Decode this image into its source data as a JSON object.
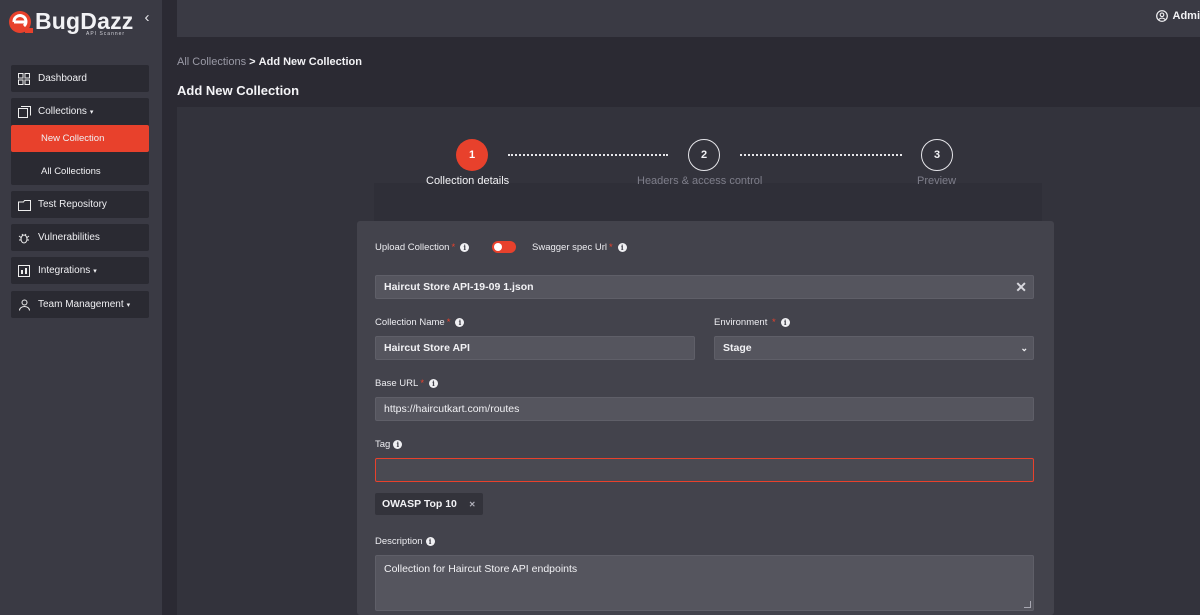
{
  "app": {
    "logo_text": "BugDazz",
    "logo_sub": "API Scanner"
  },
  "sidebar": {
    "items": [
      {
        "label": "Dashboard",
        "icon": "dashboard-grid-icon"
      },
      {
        "label": "Collections",
        "icon": "collections-icon",
        "submenu": [
          "New Collection",
          "All Collections"
        ]
      },
      {
        "label": "Test Repository",
        "icon": "test-repository-icon"
      },
      {
        "label": "Vulnerabilities",
        "icon": "bug-icon"
      },
      {
        "label": "Integrations",
        "icon": "integrations-icon"
      },
      {
        "label": "Team Management",
        "icon": "team-icon"
      }
    ],
    "active_subitem": "New Collection"
  },
  "topbar": {
    "user_label": "Admi"
  },
  "breadcrumb": {
    "parent": "All Collections",
    "separator": ">",
    "current": "Add New Collection"
  },
  "page_title": "Add New Collection",
  "stepper": {
    "steps": [
      {
        "number": "1",
        "label": "Collection details",
        "state": "current"
      },
      {
        "number": "2",
        "label": "Headers & access control",
        "state": "upcoming"
      },
      {
        "number": "3",
        "label": "Preview",
        "state": "upcoming"
      }
    ]
  },
  "form": {
    "upload_collection_label": "Upload Collection",
    "swagger_label": "Swagger spec Url",
    "file_value": "Haircut Store API-19-09 1.json",
    "collection_name_label": "Collection Name",
    "collection_name_value": "Haircut Store API",
    "environment_label": "Environment",
    "environment_value": "Stage",
    "base_url_label": "Base URL",
    "base_url_value": "https://haircutkart.com/routes",
    "tag_label": "Tag",
    "tag_value": "",
    "tags": [
      "OWASP Top 10"
    ],
    "description_label": "Description",
    "description_value": "Collection for Haircut Store API endpoints"
  },
  "colors": {
    "accent": "#e8412c",
    "sidebar_bg": "#3a3a44",
    "page_bg": "#2b2a33",
    "card_bg": "#43434c"
  }
}
